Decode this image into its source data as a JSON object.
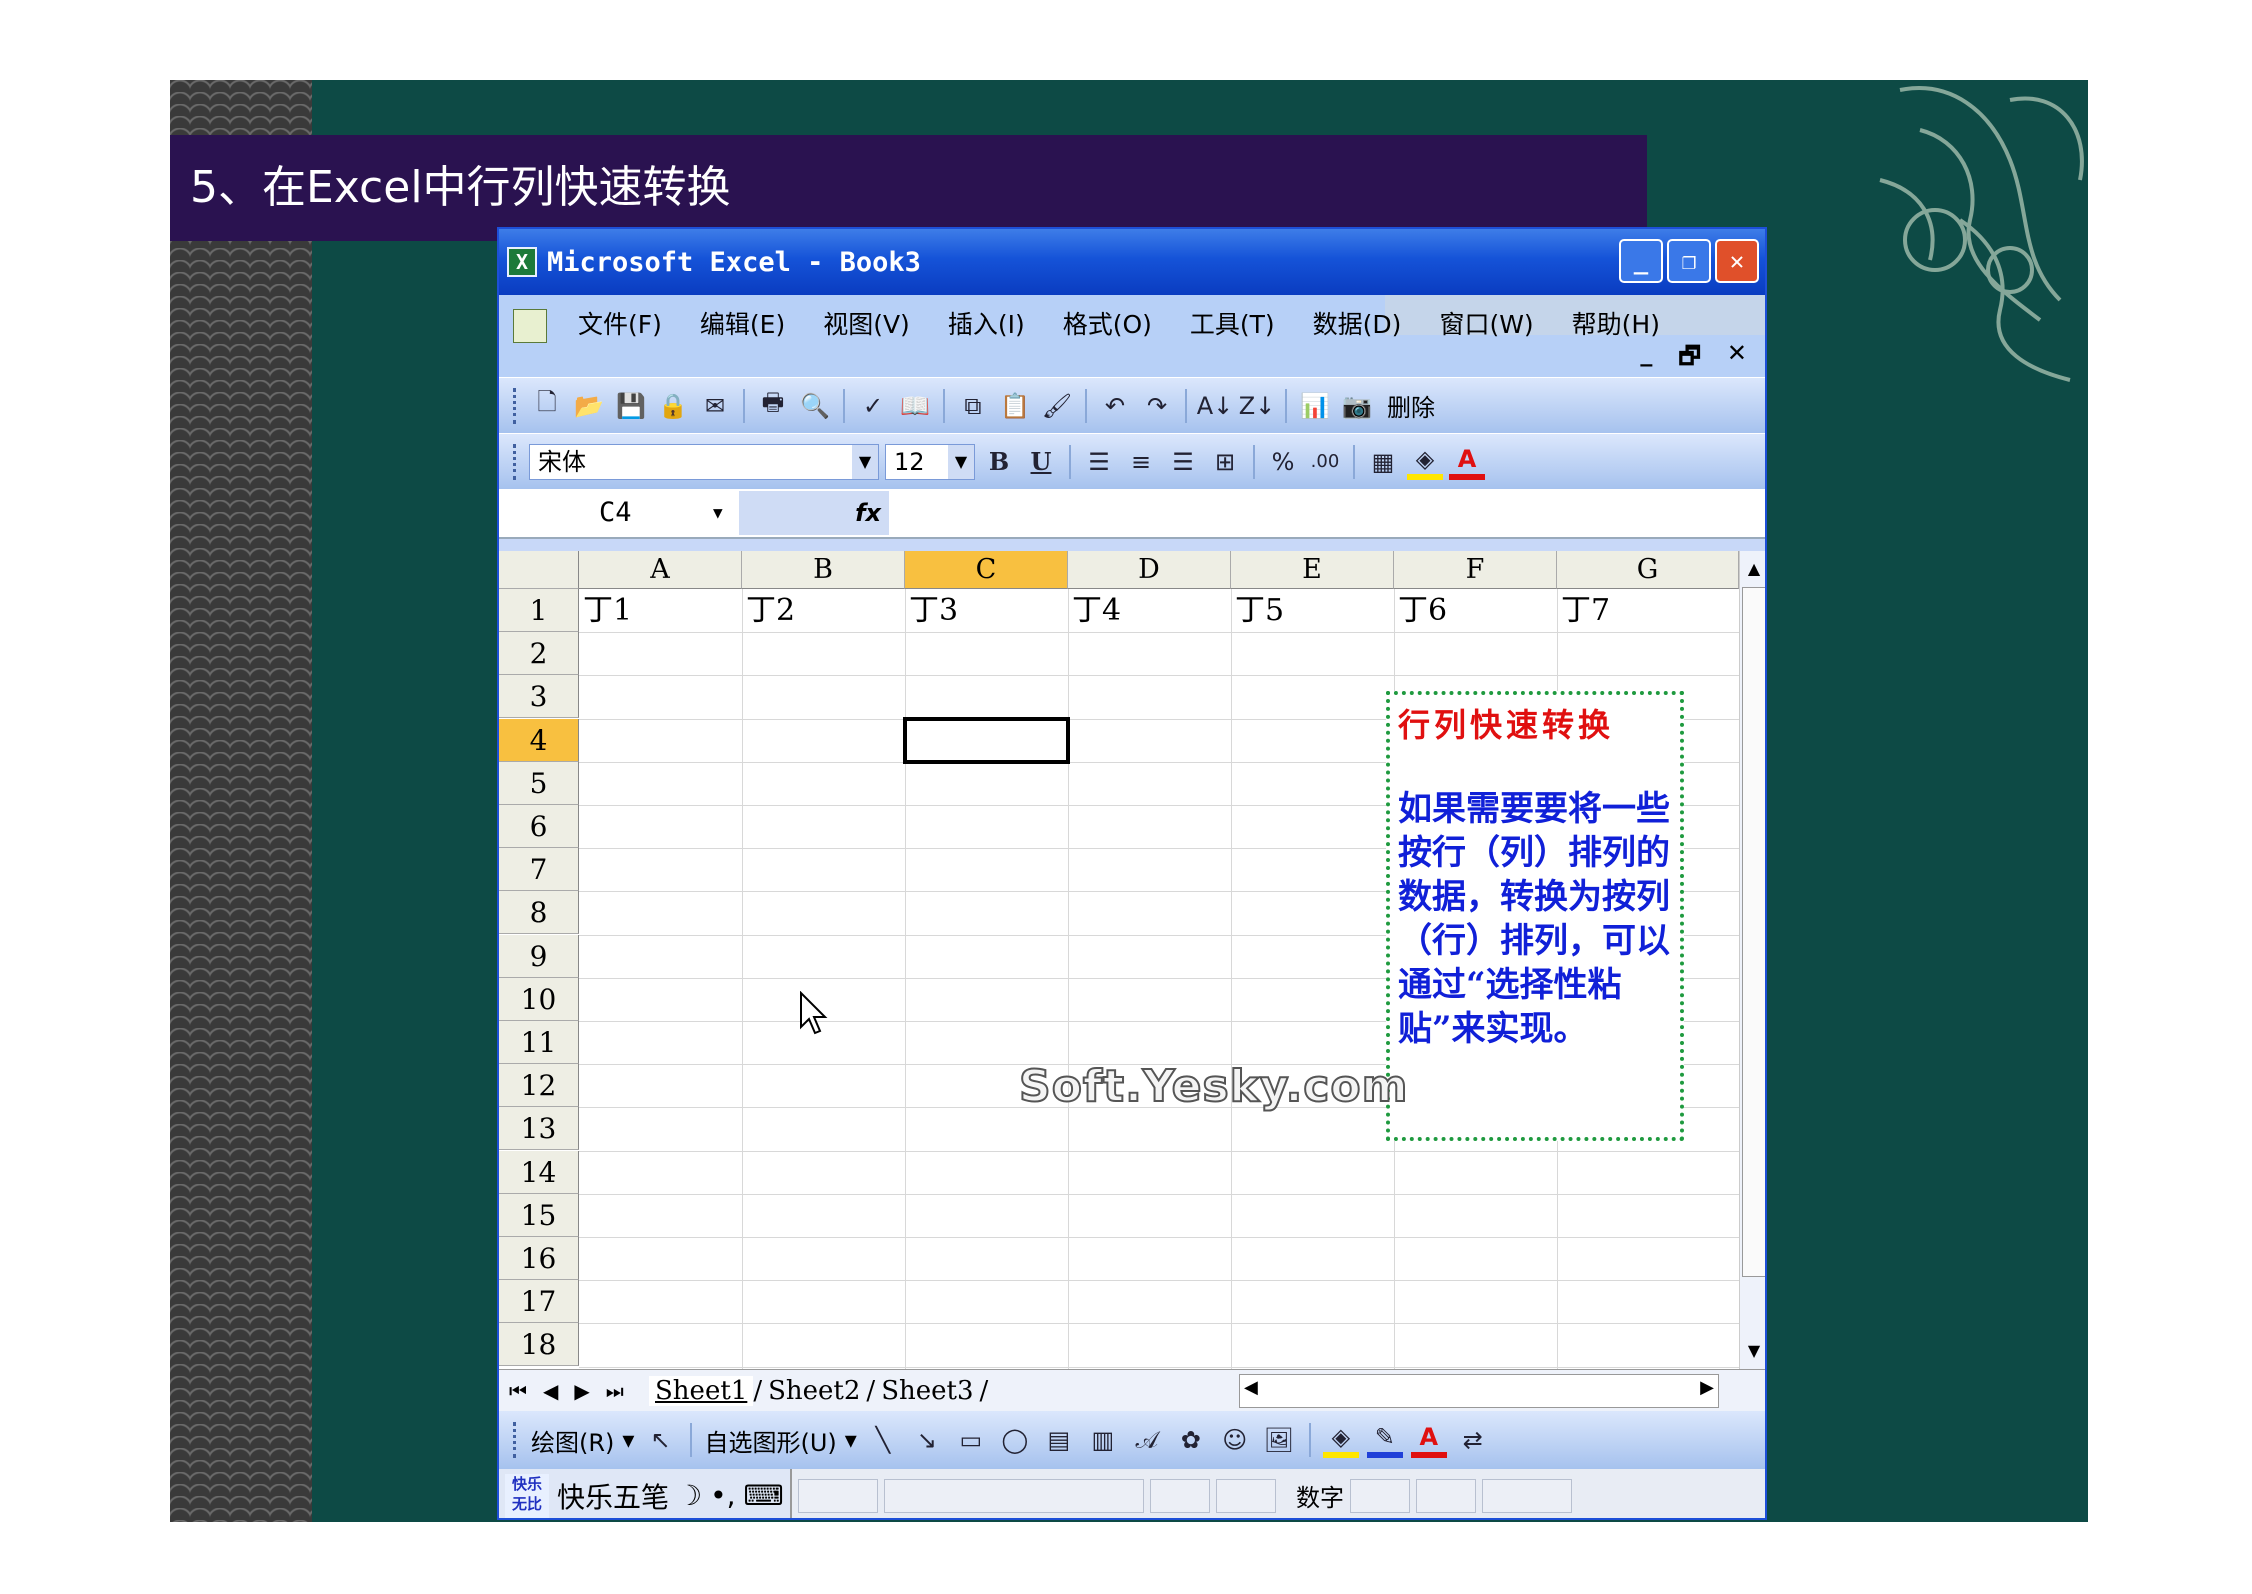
{
  "slide": {
    "title": "5、在Excel中行列快速转换"
  },
  "window": {
    "title": "Microsoft Excel - Book3",
    "buttons": {
      "minimize": "_",
      "restore": "❐",
      "close": "✕"
    }
  },
  "menu": {
    "items": [
      "文件(F)",
      "编辑(E)",
      "视图(V)",
      "插入(I)",
      "格式(O)",
      "工具(T)",
      "数据(D)",
      "窗口(W)",
      "帮助(H)"
    ],
    "mdi": {
      "minimize": "_",
      "restore": "🗗",
      "close": "✕"
    }
  },
  "standard_toolbar": {
    "delete_label": "删除"
  },
  "format_toolbar": {
    "font": "宋体",
    "size": "12",
    "bold": "B",
    "underline": "U",
    "percent": "%",
    "decimal": ".00",
    "fill_color": "#ffe600",
    "font_color": "#e01010"
  },
  "formula_bar": {
    "name_box": "C4",
    "fx": "fx"
  },
  "sheet": {
    "columns": [
      "A",
      "B",
      "C",
      "D",
      "E",
      "F",
      "G"
    ],
    "selected_column": "C",
    "rows": [
      "1",
      "2",
      "3",
      "4",
      "5",
      "6",
      "7",
      "8",
      "9",
      "10",
      "11",
      "12",
      "13",
      "14",
      "15",
      "16",
      "17",
      "18"
    ],
    "selected_row": "4",
    "row1_values": [
      "丁1",
      "丁2",
      "丁3",
      "丁4",
      "丁5",
      "丁6",
      "丁7"
    ]
  },
  "note": {
    "title": "行列快速转换",
    "body": "如果需要要将一些按行（列）排列的数据，转换为按列（行）排列，可以通过“选择性粘贴”来实现。"
  },
  "watermark": "Soft.Yesky.com",
  "sheet_tabs": {
    "tabs": [
      "Sheet1",
      "Sheet2",
      "Sheet3"
    ],
    "active": "Sheet1"
  },
  "drawing_toolbar": {
    "draw_label": "绘图(R)",
    "autoshapes_label": "自选图形(U)"
  },
  "status_bar": {
    "ime_name": "快乐五笔",
    "ime_logo": "快乐无比",
    "num_indicator": "数字"
  }
}
